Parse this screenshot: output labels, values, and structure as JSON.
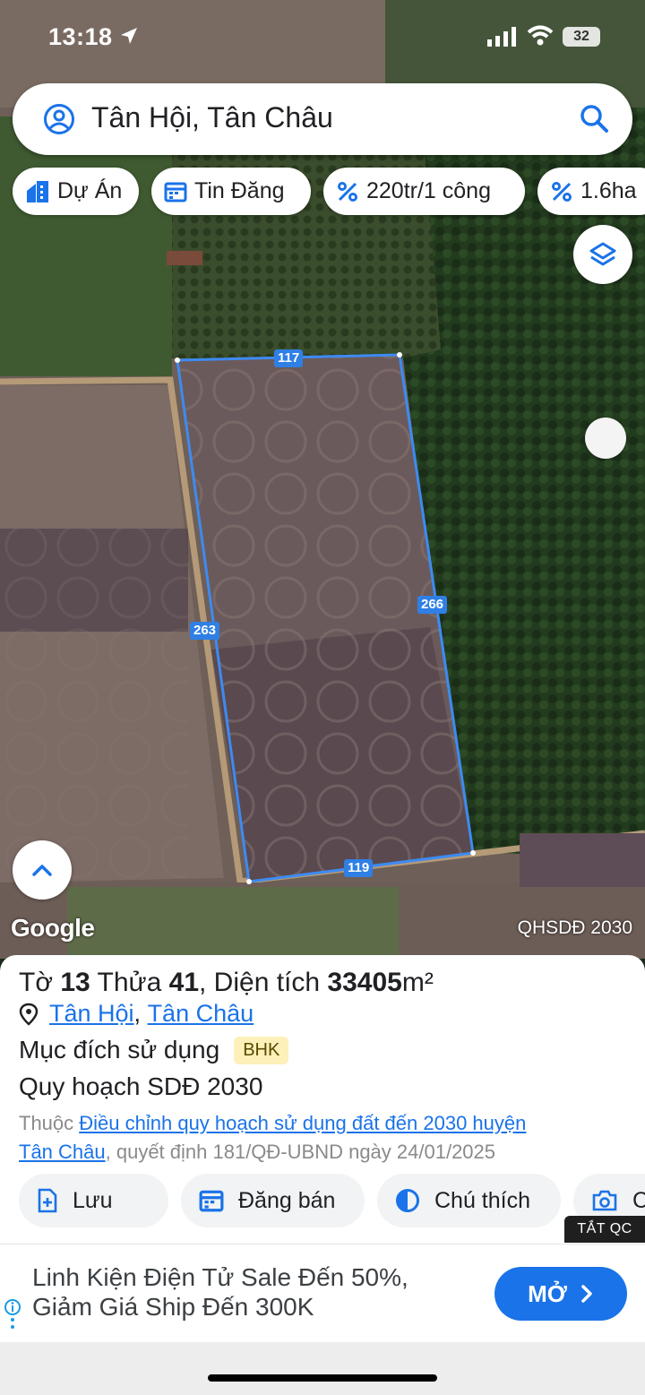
{
  "status": {
    "time": "13:18",
    "battery": "32"
  },
  "search": {
    "query": "Tân Hội, Tân Châu"
  },
  "chips": [
    "Dự Án",
    "Tin Đăng",
    "220tr/1 công",
    "1.6ha"
  ],
  "map": {
    "edges": {
      "top": "117",
      "right": "266",
      "left": "263",
      "bottom": "119"
    },
    "attribution": "Google",
    "layer_label": "QHSDĐ 2030"
  },
  "parcel": {
    "sheet_label": "Tờ",
    "sheet": "13",
    "plot_label": "Thửa",
    "plot": "41",
    "area_label": ", Diện tích",
    "area": "33405",
    "area_unit": "m²",
    "commune": "Tân Hội",
    "district": "Tân Châu",
    "purpose_label": "Mục đích sử dụng",
    "purpose_code": "BHK",
    "plan_label": "Quy hoạch SDĐ 2030",
    "belongs_prefix": "Thuộc ",
    "belongs_link_1": "Điều chỉnh quy hoạch sử dụng đất đến 2030 huyện",
    "belongs_link_2": "Tân Châu",
    "belongs_suffix": ", quyết định 181/QĐ-UBND ngày 24/01/2025"
  },
  "actions": [
    "Lưu",
    "Đăng bán",
    "Chú thích",
    "C"
  ],
  "ad": {
    "close_label": "TẮT QC",
    "line1": "Linh Kiện Điện Tử Sale Đến 50%,",
    "line2": "Giảm Giá Ship Đến 300K",
    "cta": "MỞ"
  },
  "colors": {
    "accent": "#1a73e8",
    "parcel_outline": "#3d8bf2",
    "badge_bg": "#fdf0b8"
  }
}
